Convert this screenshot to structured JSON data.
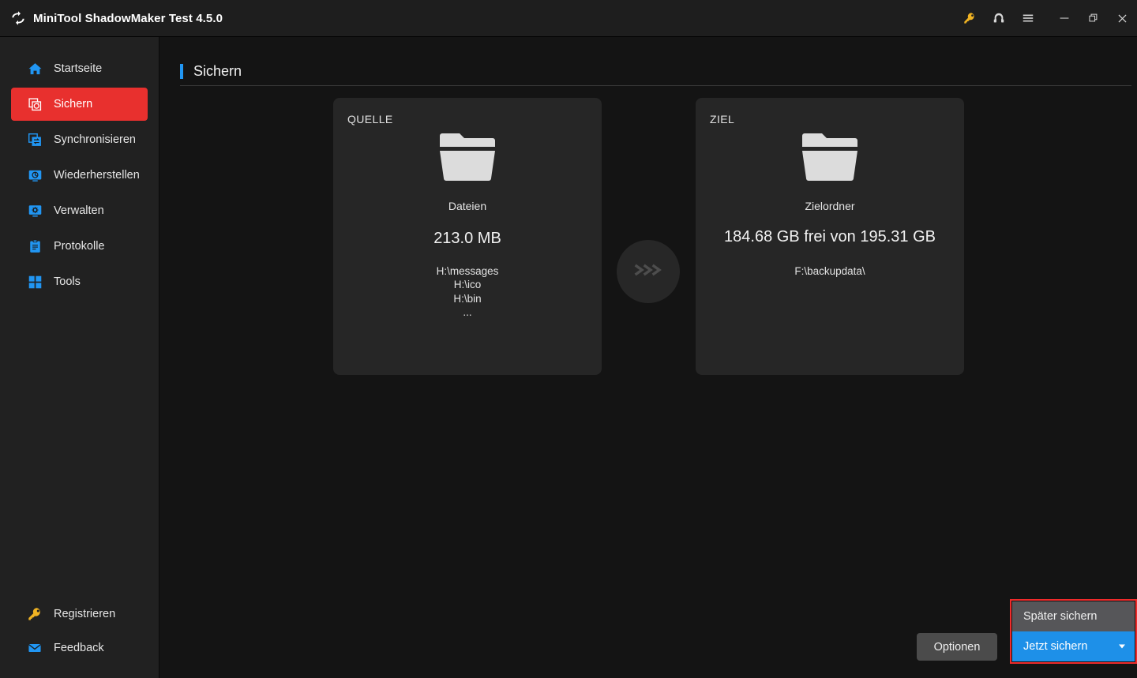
{
  "window": {
    "title": "MiniTool ShadowMaker Test 4.5.0",
    "logo_icon": "sync-arrows-icon",
    "actions": [
      {
        "name": "key-icon",
        "tooltip": "Registrieren"
      },
      {
        "name": "headset-icon",
        "tooltip": "Support"
      },
      {
        "name": "menu-icon",
        "tooltip": "Menu"
      },
      {
        "name": "minimize-icon",
        "tooltip": "Minimieren"
      },
      {
        "name": "restore-icon",
        "tooltip": "Maximieren"
      },
      {
        "name": "close-icon",
        "tooltip": "Schliessen"
      }
    ]
  },
  "sidebar": {
    "items": [
      {
        "label": "Startseite",
        "icon": "home-icon",
        "active": false
      },
      {
        "label": "Sichern",
        "icon": "backup-icon",
        "active": true
      },
      {
        "label": "Synchronisieren",
        "icon": "sync-icon",
        "active": false
      },
      {
        "label": "Wiederherstellen",
        "icon": "restore-disk-icon",
        "active": false
      },
      {
        "label": "Verwalten",
        "icon": "manage-icon",
        "active": false
      },
      {
        "label": "Protokolle",
        "icon": "logs-icon",
        "active": false
      },
      {
        "label": "Tools",
        "icon": "tools-icon",
        "active": false
      }
    ],
    "bottom_items": [
      {
        "label": "Registrieren",
        "icon": "key-icon"
      },
      {
        "label": "Feedback",
        "icon": "mail-icon"
      }
    ]
  },
  "page": {
    "title": "Sichern"
  },
  "source_card": {
    "label": "QUELLE",
    "icon": "folder-icon",
    "kind": "Dateien",
    "size": "213.0 MB",
    "paths": [
      "H:\\messages",
      "H:\\ico",
      "H:\\bin",
      "..."
    ]
  },
  "transfer": {
    "icon": "triple-chevron-right-icon"
  },
  "dest_card": {
    "label": "ZIEL",
    "icon": "folder-icon",
    "kind": "Zielordner",
    "capacity": "184.68 GB frei von 195.31 GB",
    "path": "F:\\backupdata\\"
  },
  "footer": {
    "options_label": "Optionen",
    "backup_later_label": "Später sichern",
    "backup_now_label": "Jetzt sichern"
  },
  "colors": {
    "accent_blue": "#2196f3",
    "active_red": "#e8302e",
    "highlight_red": "#ef2b2b",
    "button_blue": "#1e90e8",
    "key_gold": "#f0b323"
  }
}
